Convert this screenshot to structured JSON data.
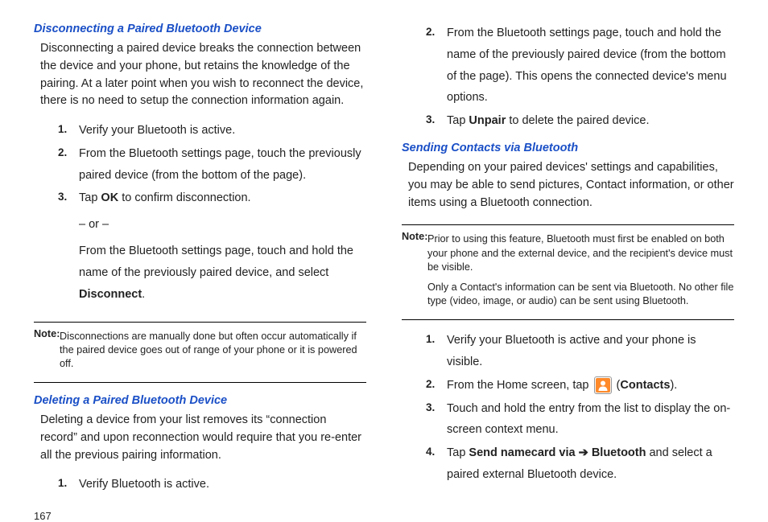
{
  "pageNumber": "167",
  "left": {
    "h1": "Disconnecting a Paired Bluetooth Device",
    "p1": "Disconnecting a paired device breaks the connection between the device and your phone, but retains the knowledge of the pairing. At a later point when you wish to reconnect the device, there is no need to setup the connection information again.",
    "s1": {
      "n": "1.",
      "t": "Verify your Bluetooth is active."
    },
    "s2": {
      "n": "2.",
      "t": "From the Bluetooth settings page, touch the previously paired device (from the bottom of the page)."
    },
    "s3": {
      "n": "3.",
      "t1": "Tap ",
      "b1": "OK",
      "t2": "  to confirm disconnection.",
      "or": "– or –",
      "t3": "From the Bluetooth settings page, touch and hold the name of the previously paired device, and select ",
      "b2": "Disconnect",
      "t4": "."
    },
    "noteLabel": "Note:",
    "note1": "Disconnections are manually done but often occur automatically if the paired device goes out of range of your phone or it is powered off.",
    "h2": "Deleting a Paired Bluetooth Device",
    "p2": "Deleting a device from your list removes its “connection record” and upon reconnection would require that you re-enter all the previous pairing information.",
    "s4": {
      "n": "1.",
      "t": "Verify Bluetooth is active."
    }
  },
  "right": {
    "s2": {
      "n": "2.",
      "t": "From the Bluetooth settings page, touch and hold the name of the previously paired device (from the bottom of the page). This opens the connected device's menu options."
    },
    "s3": {
      "n": "3.",
      "t1": "Tap ",
      "b1": "Unpair",
      "t2": " to delete the paired device."
    },
    "h1": "Sending Contacts via Bluetooth",
    "p1": "Depending on your paired devices' settings and capabilities, you may be able to send pictures, Contact information, or other items using a Bluetooth connection.",
    "noteLabel": "Note:",
    "note1": "Prior to using this feature, Bluetooth must first be enabled on both your phone and the external device, and the recipient's device must be visible.",
    "note2": "Only a Contact's information can be sent via Bluetooth. No other file type (video, image, or audio) can be sent using Bluetooth.",
    "r1": {
      "n": "1.",
      "t": "Verify your Bluetooth is active and your phone is visible."
    },
    "r2": {
      "n": "2.",
      "t1": "From the Home screen, tap ",
      "t2": " (",
      "b1": "Contacts",
      "t3": ")."
    },
    "r3": {
      "n": "3.",
      "t": "Touch and hold the entry from the list to display the on-screen context menu."
    },
    "r4": {
      "n": "4.",
      "t1": "Tap ",
      "b1": "Send namecard via",
      "arrow": " ➔ ",
      "b2": "Bluetooth",
      "t2": " and select a paired external Bluetooth device."
    }
  }
}
